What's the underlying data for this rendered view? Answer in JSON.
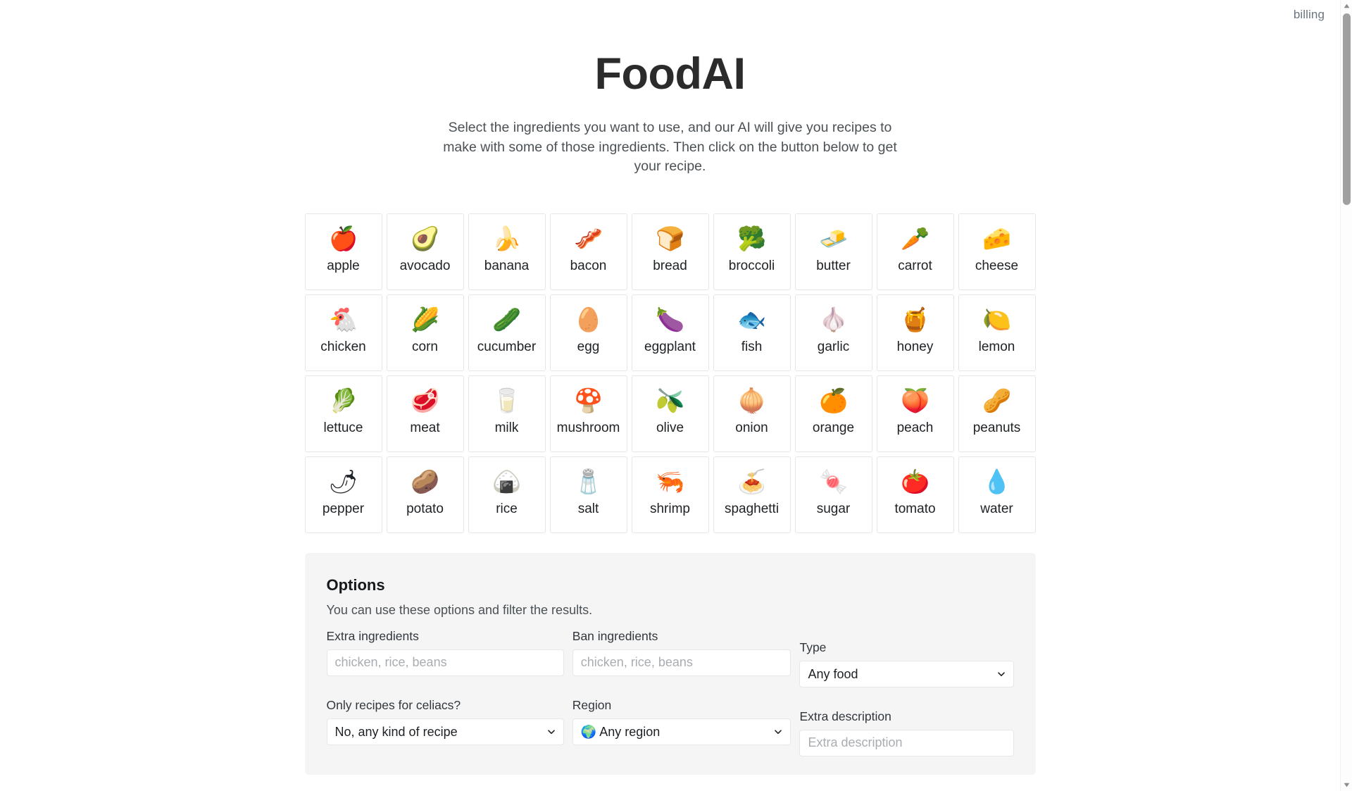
{
  "header": {
    "billing_label": "billing"
  },
  "hero": {
    "title": "FoodAI",
    "subtitle": "Select the ingredients you want to use, and our AI will give you recipes to make with some of those ingredients. Then click on the button below to get your recipe."
  },
  "ingredients": [
    {
      "label": "apple",
      "emoji": "🍎",
      "icon": "apple-icon"
    },
    {
      "label": "avocado",
      "emoji": "🥑",
      "icon": "avocado-icon"
    },
    {
      "label": "banana",
      "emoji": "🍌",
      "icon": "banana-icon"
    },
    {
      "label": "bacon",
      "emoji": "🥓",
      "icon": "bacon-icon"
    },
    {
      "label": "bread",
      "emoji": "🍞",
      "icon": "bread-icon"
    },
    {
      "label": "broccoli",
      "emoji": "🥦",
      "icon": "broccoli-icon"
    },
    {
      "label": "butter",
      "emoji": "🧈",
      "icon": "butter-icon"
    },
    {
      "label": "carrot",
      "emoji": "🥕",
      "icon": "carrot-icon"
    },
    {
      "label": "cheese",
      "emoji": "🧀",
      "icon": "cheese-icon"
    },
    {
      "label": "chicken",
      "emoji": "🐔",
      "icon": "chicken-icon"
    },
    {
      "label": "corn",
      "emoji": "🌽",
      "icon": "corn-icon"
    },
    {
      "label": "cucumber",
      "emoji": "🥒",
      "icon": "cucumber-icon"
    },
    {
      "label": "egg",
      "emoji": "🥚",
      "icon": "egg-icon"
    },
    {
      "label": "eggplant",
      "emoji": "🍆",
      "icon": "eggplant-icon"
    },
    {
      "label": "fish",
      "emoji": "🐟",
      "icon": "fish-icon"
    },
    {
      "label": "garlic",
      "emoji": "🧄",
      "icon": "garlic-icon"
    },
    {
      "label": "honey",
      "emoji": "🍯",
      "icon": "honey-icon"
    },
    {
      "label": "lemon",
      "emoji": "🍋",
      "icon": "lemon-icon"
    },
    {
      "label": "lettuce",
      "emoji": "🥬",
      "icon": "lettuce-icon"
    },
    {
      "label": "meat",
      "emoji": "🥩",
      "icon": "meat-icon"
    },
    {
      "label": "milk",
      "emoji": "🥛",
      "icon": "milk-icon"
    },
    {
      "label": "mushroom",
      "emoji": "🍄",
      "icon": "mushroom-icon"
    },
    {
      "label": "olive",
      "emoji": "🫒",
      "icon": "olive-icon"
    },
    {
      "label": "onion",
      "emoji": "🧅",
      "icon": "onion-icon"
    },
    {
      "label": "orange",
      "emoji": "🍊",
      "icon": "orange-icon"
    },
    {
      "label": "peach",
      "emoji": "🍑",
      "icon": "peach-icon"
    },
    {
      "label": "peanuts",
      "emoji": "🥜",
      "icon": "peanuts-icon"
    },
    {
      "label": "pepper",
      "emoji": "🌶",
      "icon": "pepper-icon"
    },
    {
      "label": "potato",
      "emoji": "🥔",
      "icon": "potato-icon"
    },
    {
      "label": "rice",
      "emoji": "🍙",
      "icon": "rice-icon"
    },
    {
      "label": "salt",
      "emoji": "🧂",
      "icon": "salt-icon"
    },
    {
      "label": "shrimp",
      "emoji": "🦐",
      "icon": "shrimp-icon"
    },
    {
      "label": "spaghetti",
      "emoji": "🍝",
      "icon": "spaghetti-icon"
    },
    {
      "label": "sugar",
      "emoji": "🍬",
      "icon": "sugar-icon"
    },
    {
      "label": "tomato",
      "emoji": "🍅",
      "icon": "tomato-icon"
    },
    {
      "label": "water",
      "emoji": "💧",
      "icon": "water-icon"
    }
  ],
  "options": {
    "title": "Options",
    "subtitle": "You can use these options and filter the results.",
    "extra_ingredients": {
      "label": "Extra ingredients",
      "placeholder": "chicken, rice, beans",
      "value": ""
    },
    "ban_ingredients": {
      "label": "Ban ingredients",
      "placeholder": "chicken, rice, beans",
      "value": ""
    },
    "type": {
      "label": "Type",
      "selected": "Any food",
      "options": [
        "Any food"
      ]
    },
    "celiacs": {
      "label": "Only recipes for celiacs?",
      "selected": "No, any kind of recipe",
      "options": [
        "No, any kind of recipe"
      ]
    },
    "region": {
      "label": "Region",
      "selected": "🌍 Any region",
      "options": [
        "🌍 Any region"
      ]
    },
    "extra_description": {
      "label": "Extra description",
      "placeholder": "Extra description",
      "value": ""
    }
  },
  "colors": {
    "page_bg": "#ffffff",
    "panel_bg": "#f5f5f5",
    "card_border": "#e4e6e8",
    "text_primary": "#212529",
    "text_muted": "#6c757d",
    "scrollbar_thumb": "#a0a0a0"
  }
}
